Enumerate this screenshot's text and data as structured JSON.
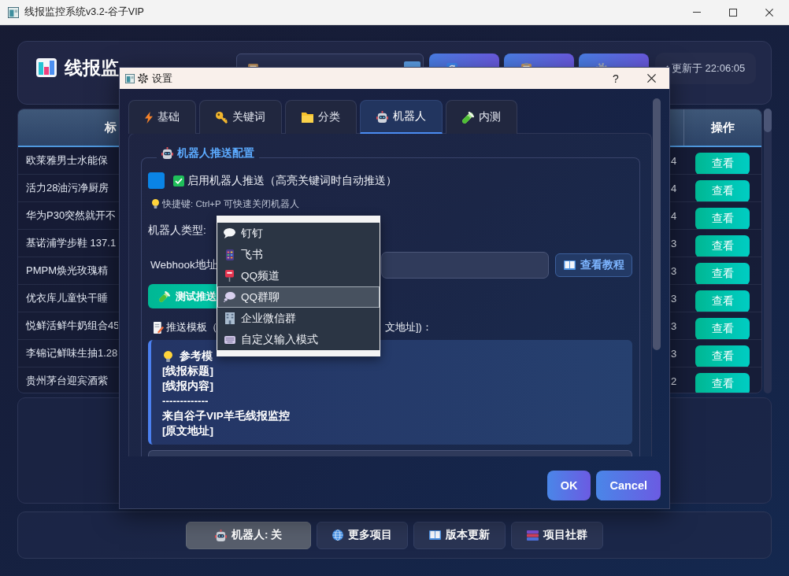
{
  "window": {
    "title": "线报监控系统v3.2-谷子VIP"
  },
  "header": {
    "app_title": "线报监",
    "buttons": [
      {
        "kind": "refresh"
      },
      {
        "kind": "log"
      },
      {
        "kind": "settings"
      }
    ],
    "status": "更新于 22:06:05"
  },
  "table": {
    "header": {
      "column_1": "标",
      "column_3": "操作"
    },
    "rows": [
      {
        "column_1": "欧莱雅男士水能保",
        "column_2": "4",
        "column_3": "查看"
      },
      {
        "column_1": "活力28油污净厨房",
        "column_2": "4",
        "column_3": "查看"
      },
      {
        "column_1": "华为P30突然就开不",
        "column_2": "4",
        "column_3": "查看"
      },
      {
        "column_1": "基诺浦学步鞋 137.1",
        "column_2": "3",
        "column_3": "查看"
      },
      {
        "column_1": "PMPM焕光玫瑰精",
        "column_2": "3",
        "column_3": "查看"
      },
      {
        "column_1": "优衣库儿童快干睡",
        "column_2": "3",
        "column_3": "查看"
      },
      {
        "column_1": "悦鲜活鲜牛奶组合45",
        "column_2": "3",
        "column_3": "查看"
      },
      {
        "column_1": "李锦记鲜味生抽1.28",
        "column_2": "3",
        "column_3": "查看"
      },
      {
        "column_1": "贵州茅台迎宾酒紫",
        "column_2": "2",
        "column_3": "查看"
      }
    ]
  },
  "bottom_toolbar": {
    "robot_toggle": {
      "label": "机器人: 关",
      "on": false
    },
    "buttons": [
      "更多项目",
      "版本更新",
      "项目社群"
    ]
  },
  "settings_dialog": {
    "title": "设置",
    "help_button": "?",
    "tabs": [
      {
        "label": "基础",
        "selected": false
      },
      {
        "label": "关键词",
        "selected": false
      },
      {
        "label": "分类",
        "selected": false
      },
      {
        "label": "机器人",
        "selected": true
      },
      {
        "label": "内测",
        "selected": false
      }
    ],
    "robot_group": {
      "title": "机器人推送配置",
      "enable_push": {
        "label": "启用机器人推送（高亮关键词时自动推送）",
        "checked": true
      },
      "hint": "快捷键: Ctrl+P 可快速关闭机器人",
      "type_label": "机器人类型:",
      "type_dropdown": {
        "open": true,
        "options": [
          {
            "label": "钉钉",
            "selected": false
          },
          {
            "label": "飞书",
            "selected": false
          },
          {
            "label": "QQ频道",
            "selected": false
          },
          {
            "label": "QQ群聊",
            "selected": true
          },
          {
            "label": "企业微信群",
            "selected": false
          },
          {
            "label": "自定义输入模式",
            "selected": false
          }
        ]
      },
      "webhook_label": "Webhook地址",
      "tutorial_button": "查看教程",
      "test_button": "测试推送",
      "template_label": "推送模板（",
      "template_label_tail": "文地址])：",
      "reference_template": [
        "参考模",
        "[线报标题]",
        "[线报内容]",
        "-------------",
        "来自谷子VIP羊毛线报监控",
        "[原文地址]"
      ]
    },
    "buttons": [
      "OK",
      "Cancel"
    ]
  }
}
